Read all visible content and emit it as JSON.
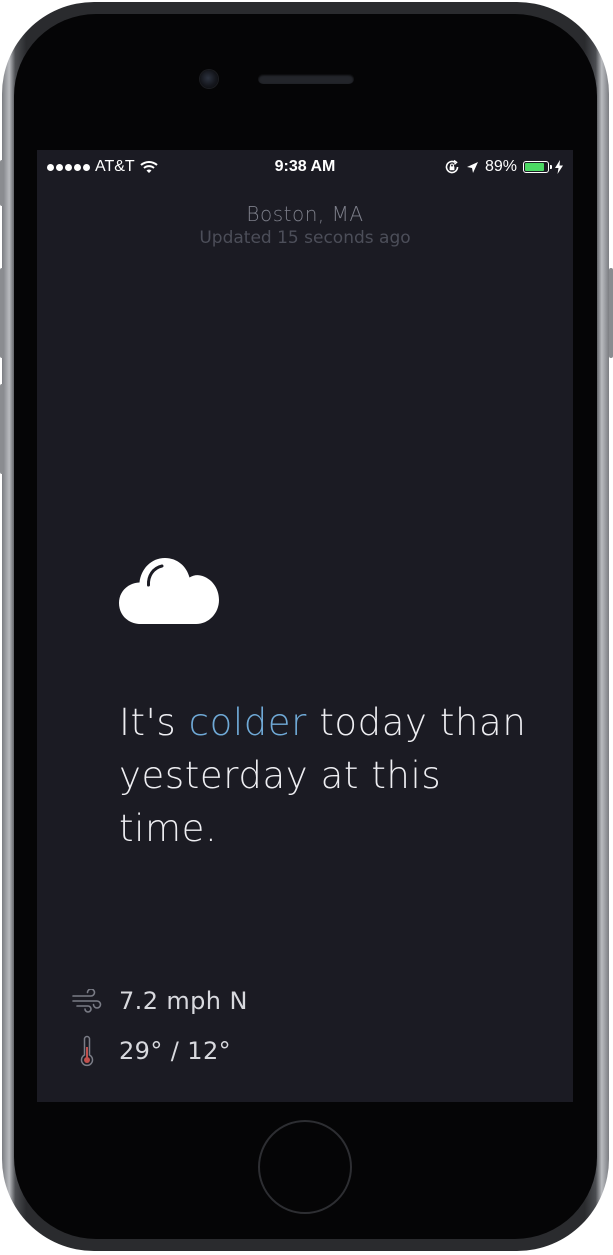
{
  "status_bar": {
    "carrier": "AT&T",
    "time": "9:38 AM",
    "battery_percent": "89%",
    "battery_level": 0.89,
    "battery_color": "#4cd964",
    "icons": [
      "signal-dots-icon",
      "wifi-icon",
      "rotation-lock-icon",
      "location-arrow-icon",
      "battery-icon",
      "charging-bolt-icon"
    ]
  },
  "location": {
    "city": "Boston, MA",
    "updated": "Updated 15 seconds ago"
  },
  "weather": {
    "icon": "cloud-icon",
    "message_prefix": "It's ",
    "message_highlight": "colder",
    "message_suffix": " today than yesterday at this time.",
    "accent_color": "#6fa9d6"
  },
  "details": {
    "wind": {
      "icon": "wind-icon",
      "value": "7.2 mph N"
    },
    "temperature": {
      "icon": "thermometer-icon",
      "value": "29° / 12°"
    }
  }
}
